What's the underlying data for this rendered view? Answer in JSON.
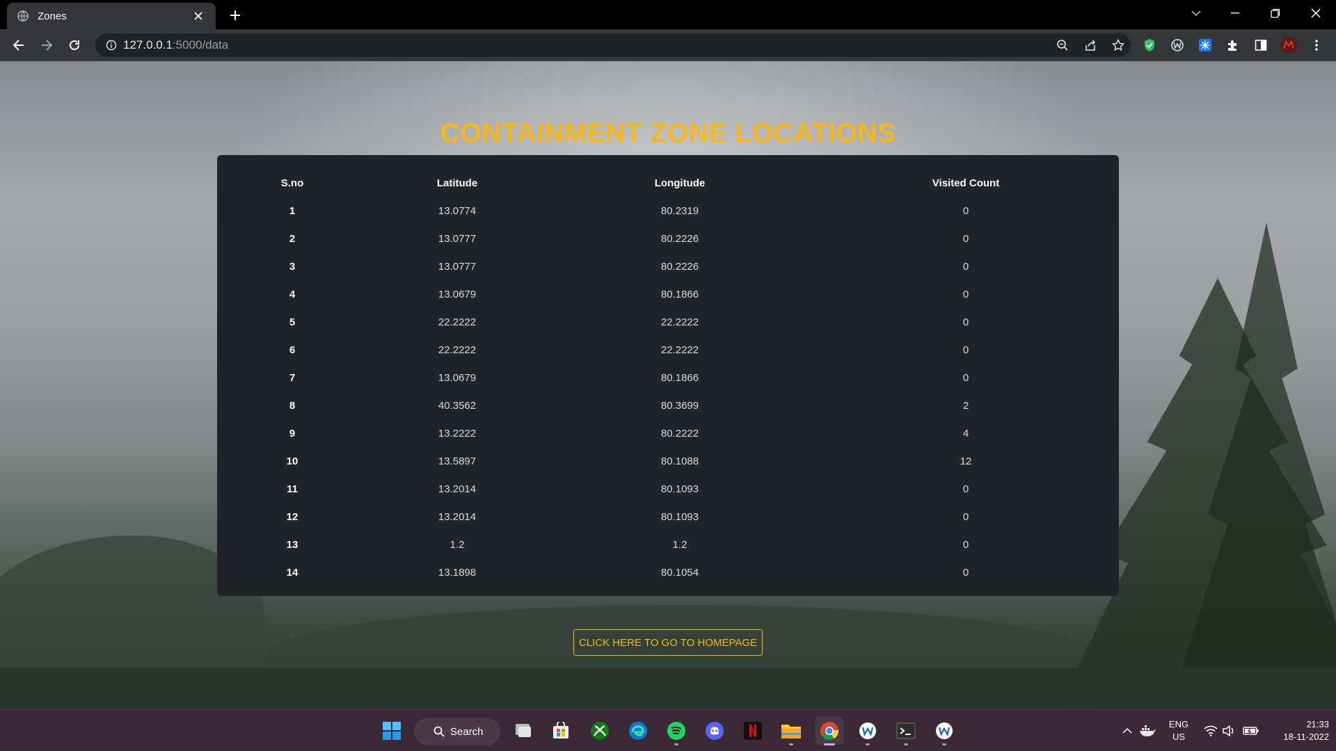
{
  "browser": {
    "tab_title": "Zones",
    "url_host": "127.0.0.1",
    "url_rest": ":5000/data"
  },
  "page": {
    "title": "CONTAINMENT ZONE LOCATIONS",
    "table": {
      "headers": [
        "S.no",
        "Latitude",
        "Longitude",
        "Visited Count"
      ],
      "rows": [
        [
          "1",
          "13.0774",
          "80.2319",
          "0"
        ],
        [
          "2",
          "13.0777",
          "80.2226",
          "0"
        ],
        [
          "3",
          "13.0777",
          "80.2226",
          "0"
        ],
        [
          "4",
          "13.0679",
          "80.1866",
          "0"
        ],
        [
          "5",
          "22.2222",
          "22.2222",
          "0"
        ],
        [
          "6",
          "22.2222",
          "22.2222",
          "0"
        ],
        [
          "7",
          "13.0679",
          "80.1866",
          "0"
        ],
        [
          "8",
          "40.3562",
          "80.3699",
          "2"
        ],
        [
          "9",
          "13.2222",
          "80.2222",
          "4"
        ],
        [
          "10",
          "13.5897",
          "80.1088",
          "12"
        ],
        [
          "11",
          "13.2014",
          "80.1093",
          "0"
        ],
        [
          "12",
          "13.2014",
          "80.1093",
          "0"
        ],
        [
          "13",
          "1.2",
          "1.2",
          "0"
        ],
        [
          "14",
          "13.1898",
          "80.1054",
          "0"
        ]
      ]
    },
    "home_button_label": "CLICK HERE TO GO TO HOMEPAGE"
  },
  "taskbar": {
    "search_label": "Search",
    "lang_line1": "ENG",
    "lang_line2": "US",
    "time": "21:33",
    "date": "18-11-2022"
  },
  "colors": {
    "accent": "#f4b81c",
    "table_bg": "#212529"
  }
}
